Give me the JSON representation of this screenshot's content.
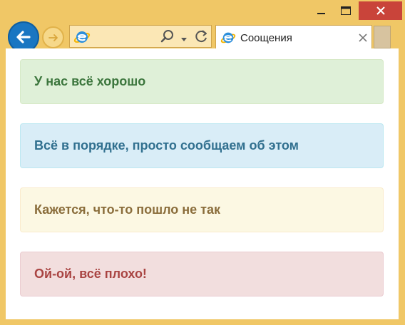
{
  "browser": {
    "tab": {
      "title": "Соощения"
    },
    "address": {
      "value": ""
    }
  },
  "alerts": [
    {
      "text": "У нас всё хорошо"
    },
    {
      "text": "Всё в порядке, просто сообщаем об этом"
    },
    {
      "text": "Кажется, что-то пошло не так"
    },
    {
      "text": "Ой-ой, всё плохо!"
    }
  ],
  "colors": {
    "frame": "#f0c766",
    "success_bg": "#dff0d8",
    "success_text": "#3c763d",
    "info_bg": "#d9edf7",
    "info_text": "#31708f",
    "warning_bg": "#fcf8e3",
    "warning_text": "#8a6d3b",
    "danger_bg": "#f2dede",
    "danger_text": "#a94442"
  }
}
